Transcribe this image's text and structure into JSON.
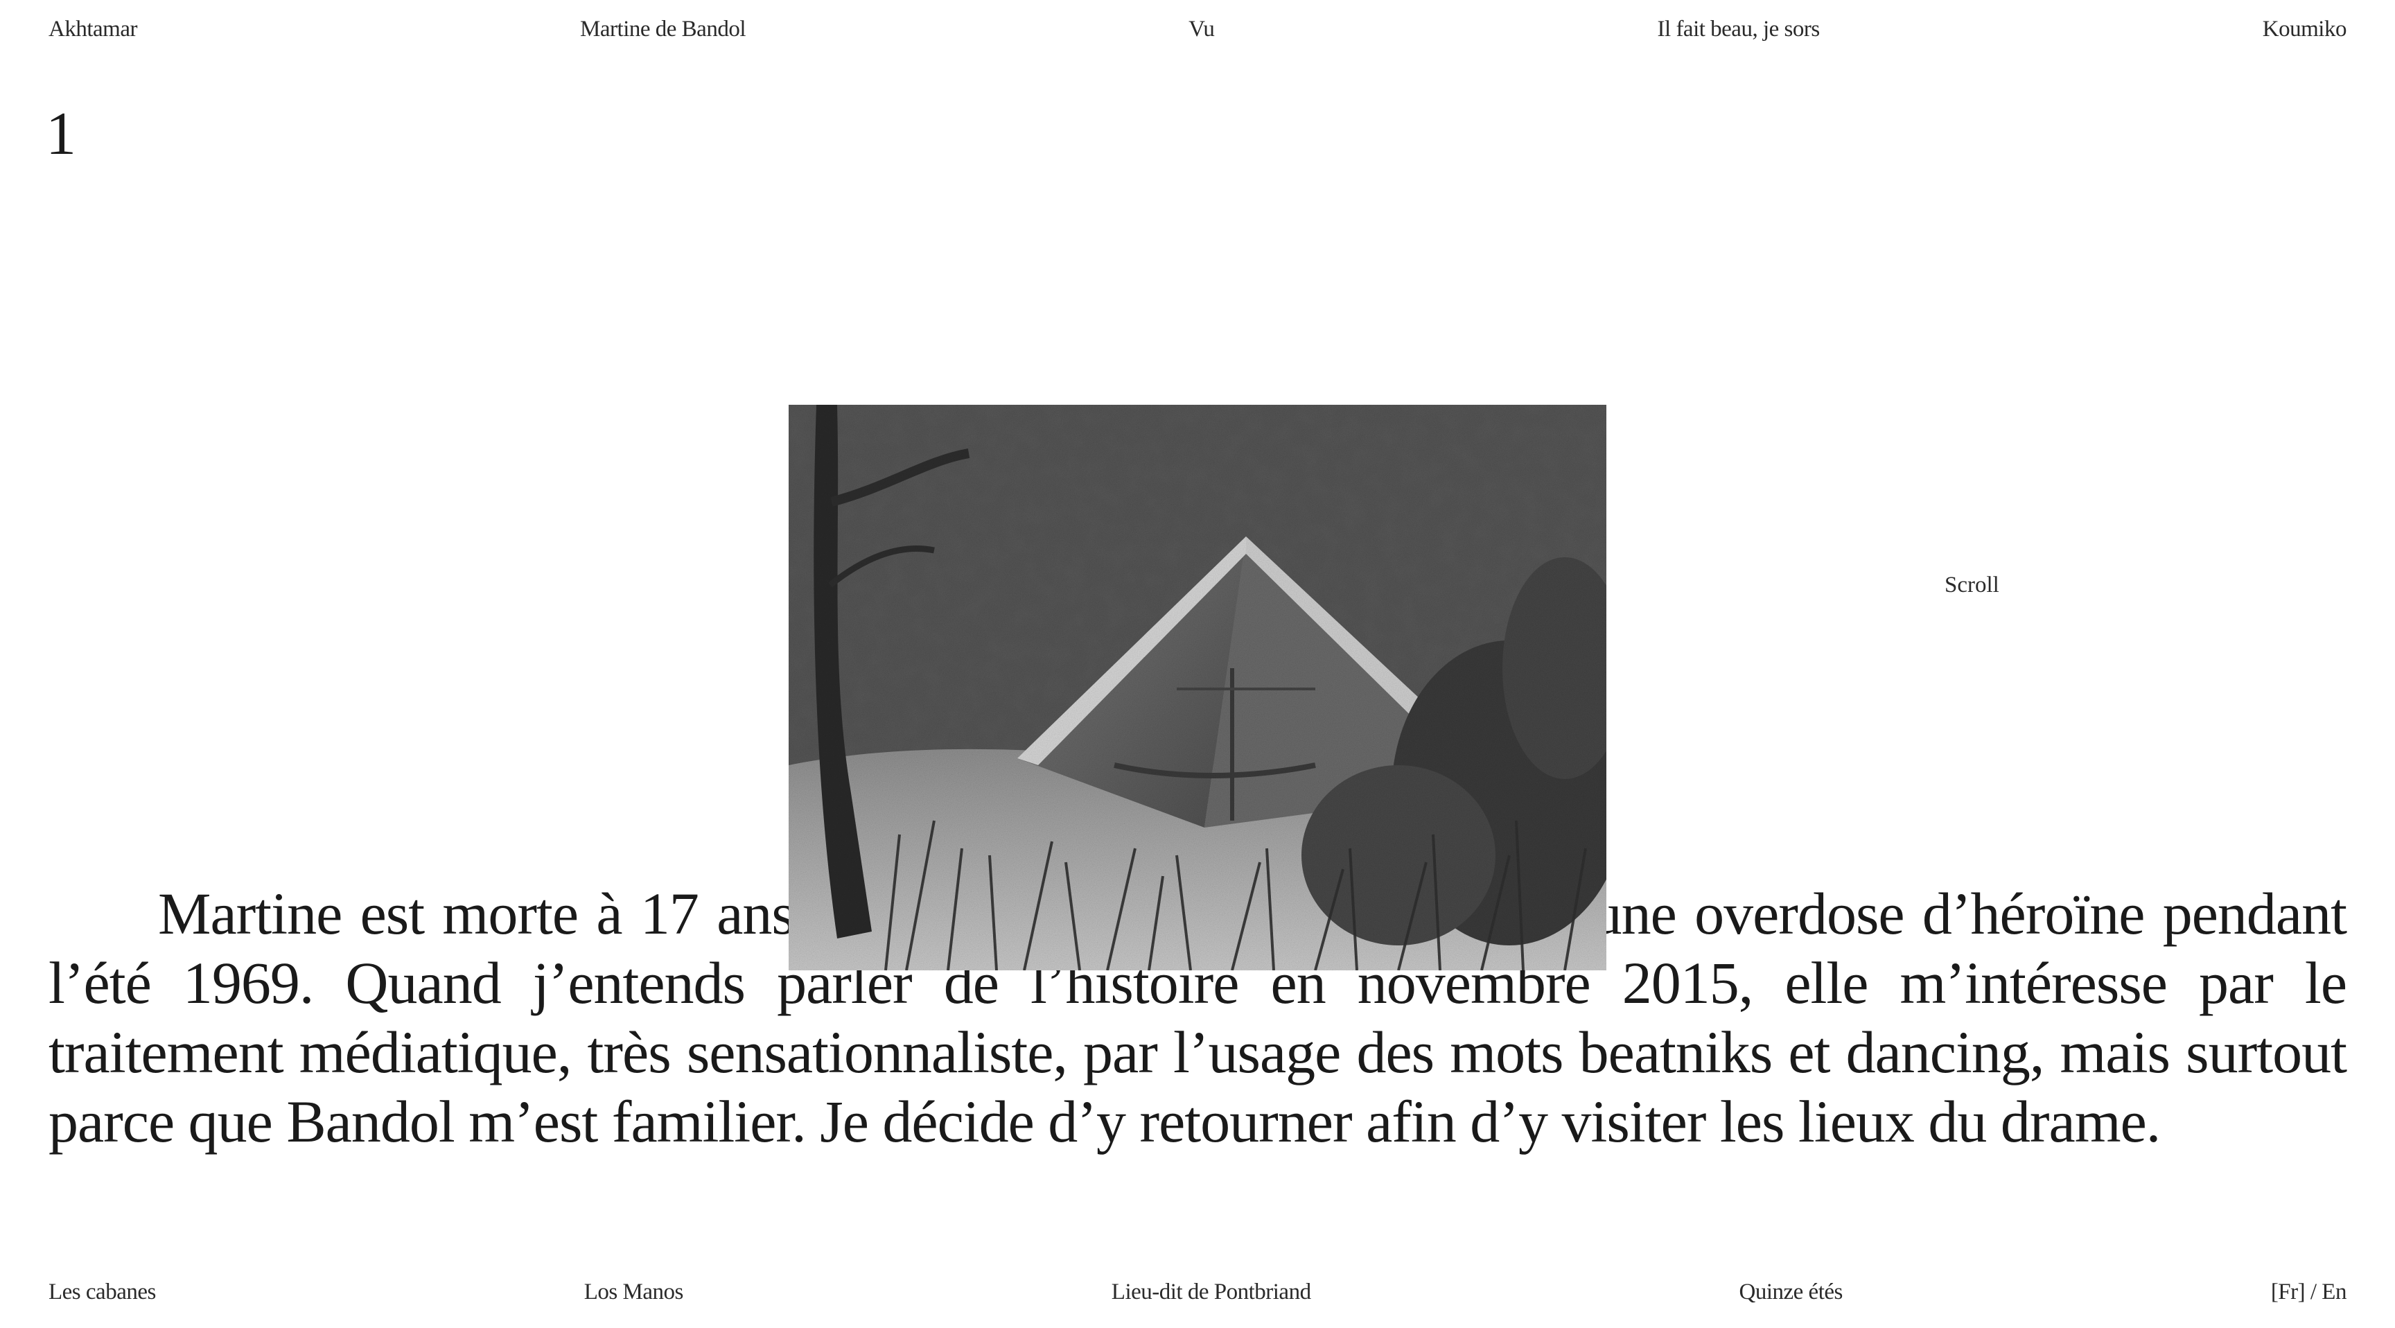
{
  "top_nav": [
    "Akhtamar",
    "Martine de Bandol",
    "Vu",
    "Il fait beau, je sors",
    "Koumiko"
  ],
  "chapter_number": "1",
  "scroll_label": "Scroll",
  "story_text": "Martine est morte à 17 ans dans une tente près de Bandol d’une overdose d’héroïne pendant l’été 1969. Quand j’entends parler de l’histoire en novembre 2015, elle m’intéresse par le traitement médiatique, très sensationnaliste, par l’usage des mots beatniks et dancing, mais surtout parce que Bandol m’est familier. Je décide d’y retourner afin d’y visiter les lieux du drame.",
  "bottom_nav": [
    "Les cabanes",
    "Los Manos",
    "Lieu-dit de Pontbriand",
    "Quinze étés",
    "[Fr] / En"
  ]
}
